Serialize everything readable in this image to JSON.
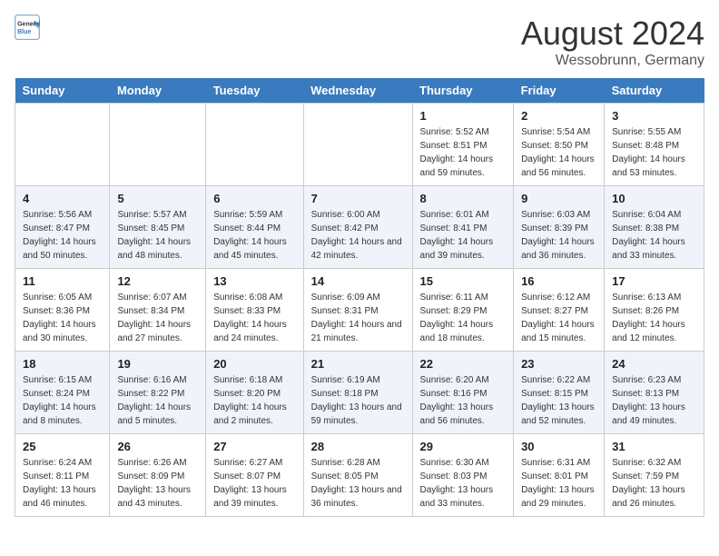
{
  "header": {
    "logo_general": "General",
    "logo_blue": "Blue",
    "main_title": "August 2024",
    "subtitle": "Wessobrunn, Germany"
  },
  "days_of_week": [
    "Sunday",
    "Monday",
    "Tuesday",
    "Wednesday",
    "Thursday",
    "Friday",
    "Saturday"
  ],
  "weeks": [
    [
      {
        "day": "",
        "sunrise": "",
        "sunset": "",
        "daylight": ""
      },
      {
        "day": "",
        "sunrise": "",
        "sunset": "",
        "daylight": ""
      },
      {
        "day": "",
        "sunrise": "",
        "sunset": "",
        "daylight": ""
      },
      {
        "day": "",
        "sunrise": "",
        "sunset": "",
        "daylight": ""
      },
      {
        "day": "1",
        "sunrise": "5:52 AM",
        "sunset": "8:51 PM",
        "daylight": "14 hours and 59 minutes."
      },
      {
        "day": "2",
        "sunrise": "5:54 AM",
        "sunset": "8:50 PM",
        "daylight": "14 hours and 56 minutes."
      },
      {
        "day": "3",
        "sunrise": "5:55 AM",
        "sunset": "8:48 PM",
        "daylight": "14 hours and 53 minutes."
      }
    ],
    [
      {
        "day": "4",
        "sunrise": "5:56 AM",
        "sunset": "8:47 PM",
        "daylight": "14 hours and 50 minutes."
      },
      {
        "day": "5",
        "sunrise": "5:57 AM",
        "sunset": "8:45 PM",
        "daylight": "14 hours and 48 minutes."
      },
      {
        "day": "6",
        "sunrise": "5:59 AM",
        "sunset": "8:44 PM",
        "daylight": "14 hours and 45 minutes."
      },
      {
        "day": "7",
        "sunrise": "6:00 AM",
        "sunset": "8:42 PM",
        "daylight": "14 hours and 42 minutes."
      },
      {
        "day": "8",
        "sunrise": "6:01 AM",
        "sunset": "8:41 PM",
        "daylight": "14 hours and 39 minutes."
      },
      {
        "day": "9",
        "sunrise": "6:03 AM",
        "sunset": "8:39 PM",
        "daylight": "14 hours and 36 minutes."
      },
      {
        "day": "10",
        "sunrise": "6:04 AM",
        "sunset": "8:38 PM",
        "daylight": "14 hours and 33 minutes."
      }
    ],
    [
      {
        "day": "11",
        "sunrise": "6:05 AM",
        "sunset": "8:36 PM",
        "daylight": "14 hours and 30 minutes."
      },
      {
        "day": "12",
        "sunrise": "6:07 AM",
        "sunset": "8:34 PM",
        "daylight": "14 hours and 27 minutes."
      },
      {
        "day": "13",
        "sunrise": "6:08 AM",
        "sunset": "8:33 PM",
        "daylight": "14 hours and 24 minutes."
      },
      {
        "day": "14",
        "sunrise": "6:09 AM",
        "sunset": "8:31 PM",
        "daylight": "14 hours and 21 minutes."
      },
      {
        "day": "15",
        "sunrise": "6:11 AM",
        "sunset": "8:29 PM",
        "daylight": "14 hours and 18 minutes."
      },
      {
        "day": "16",
        "sunrise": "6:12 AM",
        "sunset": "8:27 PM",
        "daylight": "14 hours and 15 minutes."
      },
      {
        "day": "17",
        "sunrise": "6:13 AM",
        "sunset": "8:26 PM",
        "daylight": "14 hours and 12 minutes."
      }
    ],
    [
      {
        "day": "18",
        "sunrise": "6:15 AM",
        "sunset": "8:24 PM",
        "daylight": "14 hours and 8 minutes."
      },
      {
        "day": "19",
        "sunrise": "6:16 AM",
        "sunset": "8:22 PM",
        "daylight": "14 hours and 5 minutes."
      },
      {
        "day": "20",
        "sunrise": "6:18 AM",
        "sunset": "8:20 PM",
        "daylight": "14 hours and 2 minutes."
      },
      {
        "day": "21",
        "sunrise": "6:19 AM",
        "sunset": "8:18 PM",
        "daylight": "13 hours and 59 minutes."
      },
      {
        "day": "22",
        "sunrise": "6:20 AM",
        "sunset": "8:16 PM",
        "daylight": "13 hours and 56 minutes."
      },
      {
        "day": "23",
        "sunrise": "6:22 AM",
        "sunset": "8:15 PM",
        "daylight": "13 hours and 52 minutes."
      },
      {
        "day": "24",
        "sunrise": "6:23 AM",
        "sunset": "8:13 PM",
        "daylight": "13 hours and 49 minutes."
      }
    ],
    [
      {
        "day": "25",
        "sunrise": "6:24 AM",
        "sunset": "8:11 PM",
        "daylight": "13 hours and 46 minutes."
      },
      {
        "day": "26",
        "sunrise": "6:26 AM",
        "sunset": "8:09 PM",
        "daylight": "13 hours and 43 minutes."
      },
      {
        "day": "27",
        "sunrise": "6:27 AM",
        "sunset": "8:07 PM",
        "daylight": "13 hours and 39 minutes."
      },
      {
        "day": "28",
        "sunrise": "6:28 AM",
        "sunset": "8:05 PM",
        "daylight": "13 hours and 36 minutes."
      },
      {
        "day": "29",
        "sunrise": "6:30 AM",
        "sunset": "8:03 PM",
        "daylight": "13 hours and 33 minutes."
      },
      {
        "day": "30",
        "sunrise": "6:31 AM",
        "sunset": "8:01 PM",
        "daylight": "13 hours and 29 minutes."
      },
      {
        "day": "31",
        "sunrise": "6:32 AM",
        "sunset": "7:59 PM",
        "daylight": "13 hours and 26 minutes."
      }
    ]
  ]
}
